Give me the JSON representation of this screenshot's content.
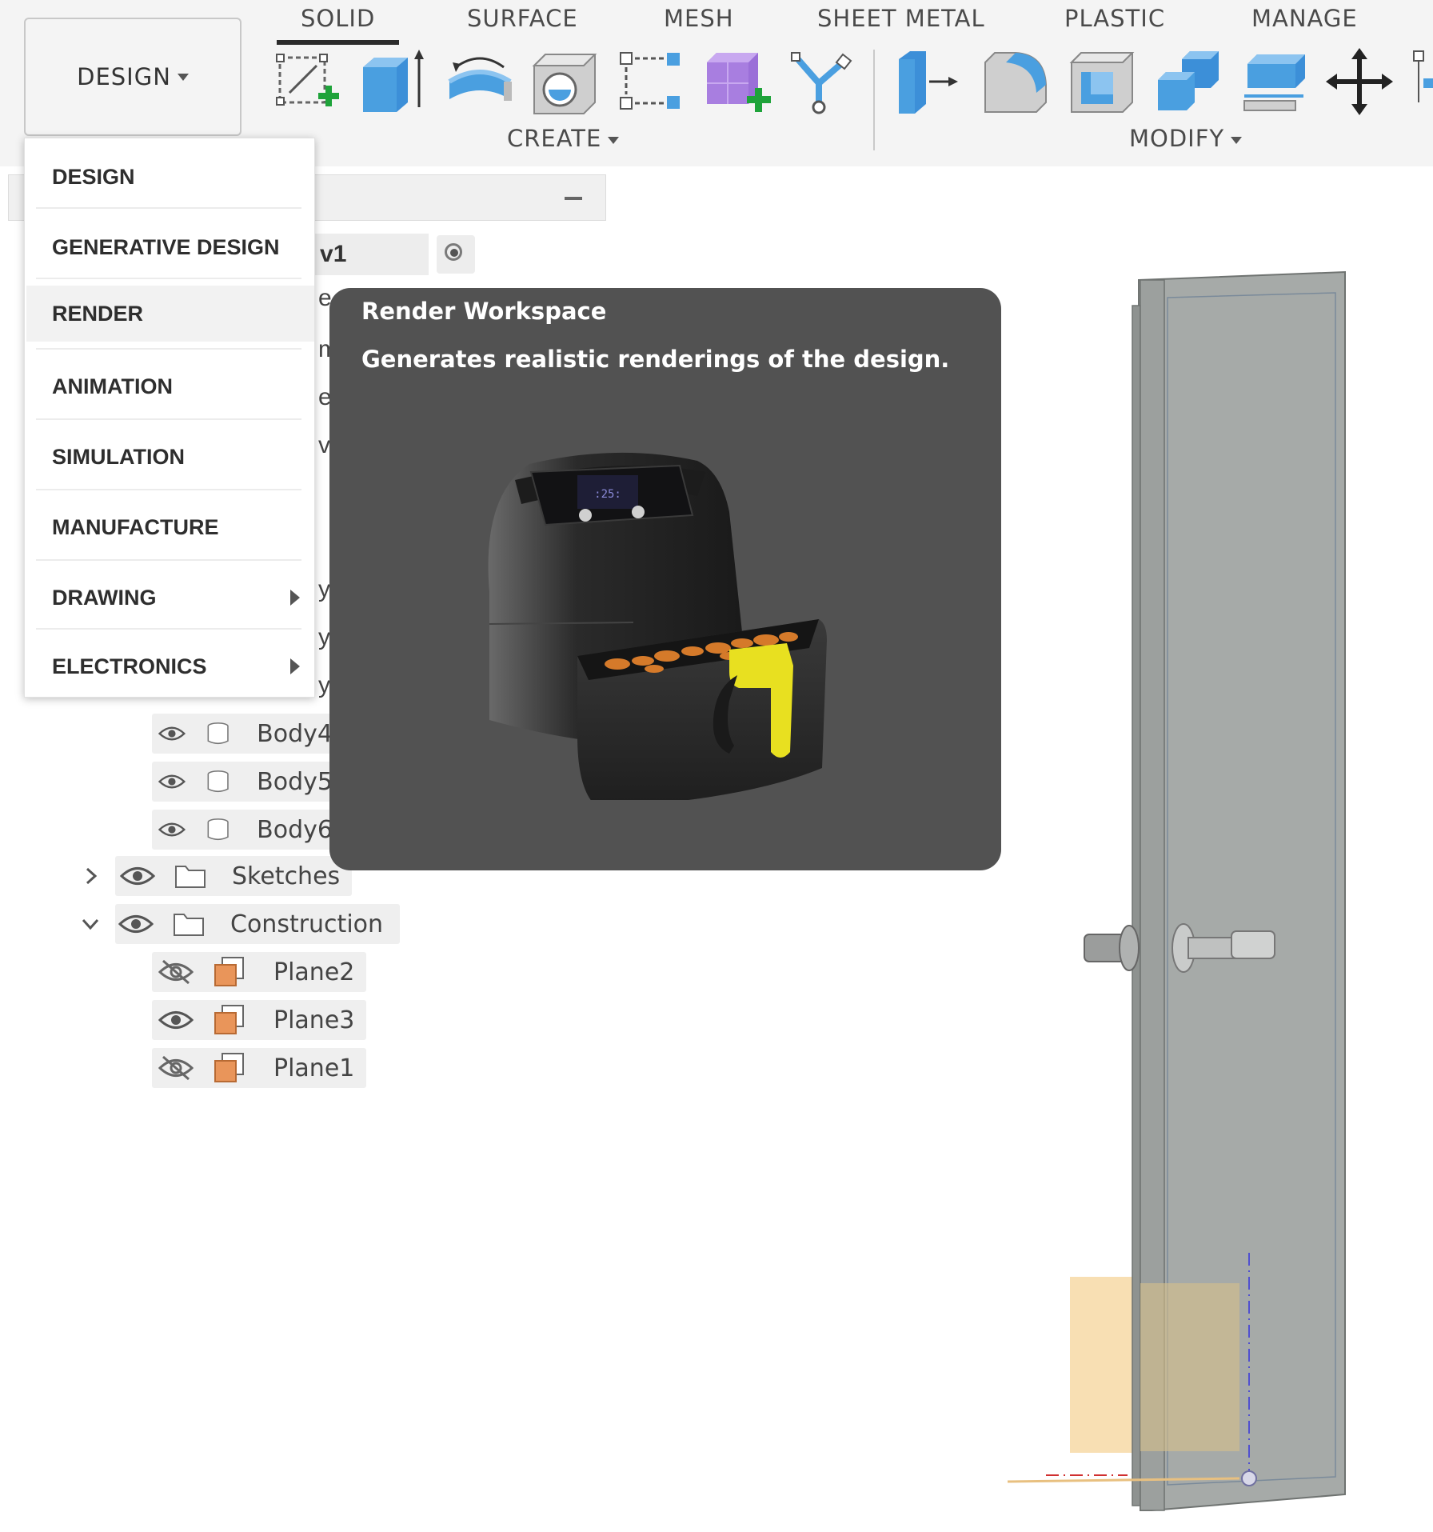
{
  "toolbar": {
    "workspace_button": "DESIGN",
    "tabs": [
      "SOLID",
      "SURFACE",
      "MESH",
      "SHEET METAL",
      "PLASTIC",
      "MANAGE"
    ],
    "active_tab": "SOLID",
    "groups": {
      "create": "CREATE",
      "modify": "MODIFY"
    },
    "create_tools": [
      "create-sketch-icon",
      "extrude-icon",
      "revolve-icon",
      "hole-icon",
      "rectangular-pattern-icon",
      "new-component-icon",
      "form-icon"
    ],
    "modify_tools": [
      "press-pull-icon",
      "fillet-icon",
      "shell-icon",
      "combine-icon",
      "offset-face-icon",
      "move-icon"
    ]
  },
  "workspace_menu": {
    "items": [
      {
        "label": "DESIGN",
        "submenu": false
      },
      {
        "label": "GENERATIVE DESIGN",
        "submenu": false
      },
      {
        "label": "RENDER",
        "submenu": false,
        "hover": true
      },
      {
        "label": "ANIMATION",
        "submenu": false
      },
      {
        "label": "SIMULATION",
        "submenu": false
      },
      {
        "label": "MANUFACTURE",
        "submenu": false
      },
      {
        "label": "DRAWING",
        "submenu": true
      },
      {
        "label": "ELECTRONICS",
        "submenu": true
      }
    ]
  },
  "tooltip": {
    "title": "Render Workspace",
    "description": "Generates realistic renderings of the design."
  },
  "browser": {
    "root_label": "ender v1",
    "peek_chars": [
      "e",
      "m",
      "e",
      "vs",
      "y1",
      "y2",
      "y3"
    ],
    "bodies": [
      "Body4",
      "Body5",
      "Body6"
    ],
    "folders": [
      {
        "label": "Sketches",
        "expanded": false
      },
      {
        "label": "Construction",
        "expanded": true
      }
    ],
    "planes": [
      {
        "label": "Plane2",
        "visible": false
      },
      {
        "label": "Plane3",
        "visible": true
      },
      {
        "label": "Plane1",
        "visible": false
      }
    ]
  },
  "colors": {
    "toolbar_bg": "#f4f4f4",
    "tooltip_bg": "#525252",
    "tool_blue": "#4a9fe0",
    "add_green": "#1ea33a",
    "door_gray": "#a6aaa8",
    "plane_orange": "#f6d49a"
  }
}
